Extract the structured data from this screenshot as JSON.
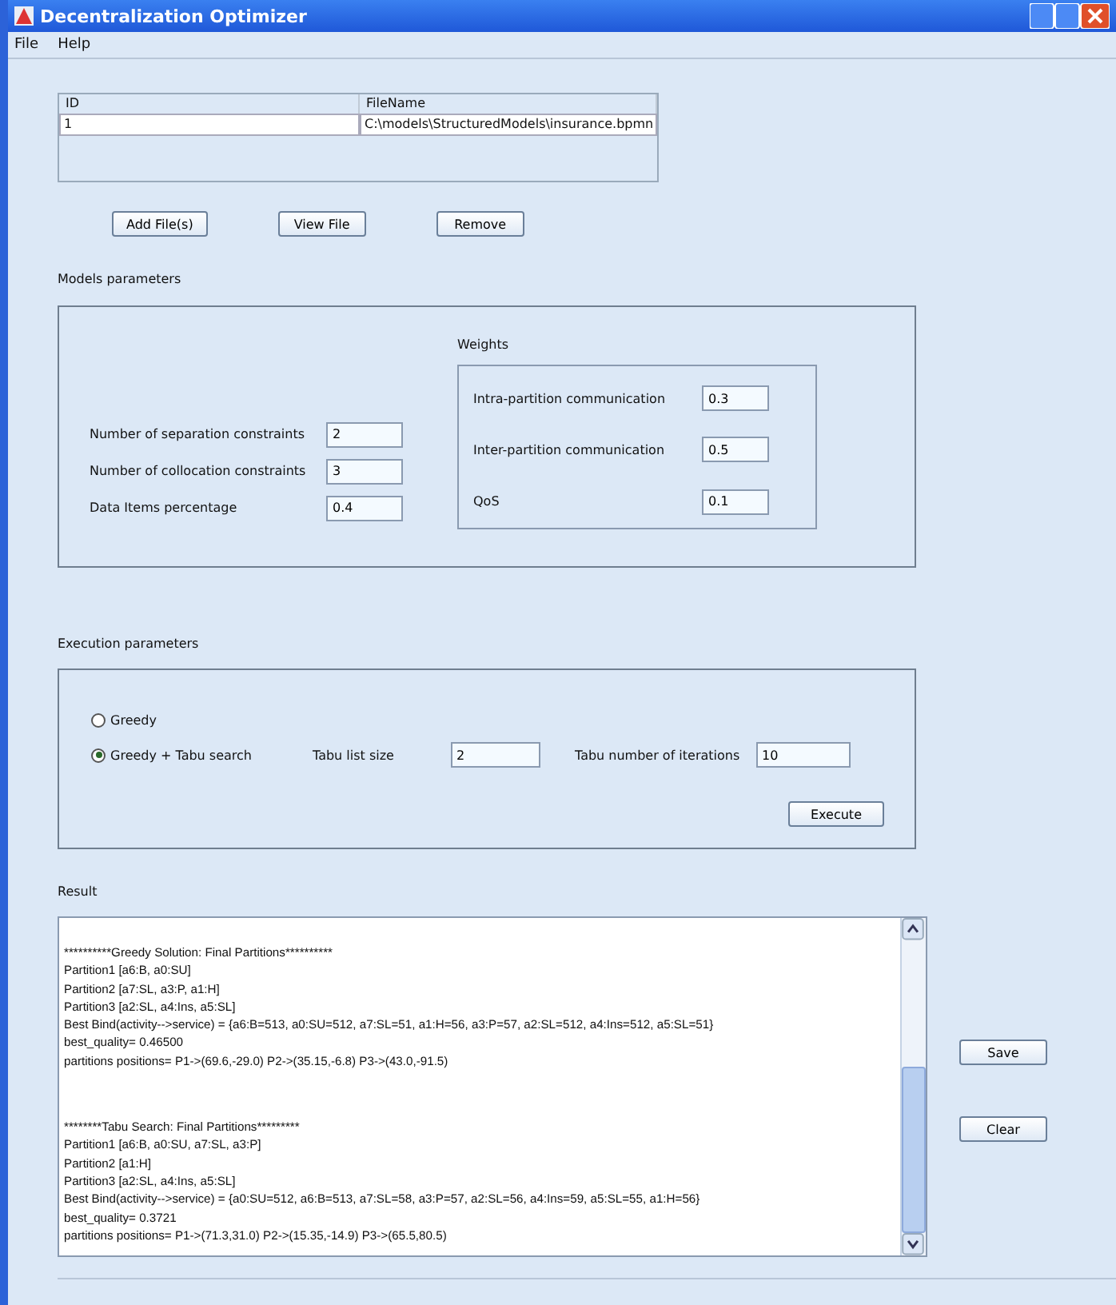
{
  "window": {
    "title": "Decentralization Optimizer"
  },
  "menu": [
    "File",
    "Help"
  ],
  "files_table": {
    "columns": [
      "ID",
      "FileName"
    ],
    "rows": [
      [
        "1",
        "C:\\models\\StructuredModels\\insurance.bpmn"
      ]
    ]
  },
  "file_buttons": [
    "Add File(s)",
    "View File",
    "Remove"
  ],
  "models": {
    "title": "Models parameters",
    "fields": [
      {
        "label": "Number of separation constraints",
        "value": "2"
      },
      {
        "label": "Number of collocation constraints",
        "value": "3"
      },
      {
        "label": "Data Items percentage",
        "value": "0.4"
      }
    ],
    "weights": {
      "title": "Weights",
      "fields": [
        {
          "label": "Intra-partition communication",
          "value": "0.3"
        },
        {
          "label": "Inter-partition communication",
          "value": "0.5"
        },
        {
          "label": "QoS",
          "value": "0.1"
        }
      ]
    }
  },
  "execution": {
    "title": "Execution parameters",
    "options": [
      {
        "label": "Greedy",
        "selected": false
      },
      {
        "label": "Greedy + Tabu search",
        "selected": true
      }
    ],
    "tabu_list_size": {
      "label": "Tabu list size",
      "value": "2"
    },
    "tabu_iterations": {
      "label": "Tabu number of iterations",
      "value": "10"
    },
    "button": "Execute"
  },
  "result": {
    "title": "Result",
    "blocks": [
      [
        "**********Greedy Solution: Final Partitions**********",
        "Partition1 [a6:B, a0:SU]",
        "Partition2 [a7:SL, a3:P, a1:H]",
        "Partition3 [a2:SL, a4:Ins, a5:SL]",
        "Best Bind(activity-->service) = {a6:B=513, a0:SU=512, a7:SL=51, a1:H=56, a3:P=57, a2:SL=512, a4:Ins=512, a5:SL=51}",
        "best_quality= 0.46500",
        "partitions positions= P1->(69.6,-29.0) P2->(35.15,-6.8) P3->(43.0,-91.5)"
      ],
      [
        "********Tabu Search: Final Partitions*********",
        "Partition1 [a6:B, a0:SU, a7:SL, a3:P]",
        "Partition2 [a1:H]",
        "Partition3 [a2:SL, a4:Ins, a5:SL]",
        "Best Bind(activity-->service) = {a0:SU=512, a6:B=513, a7:SL=58, a3:P=57, a2:SL=56, a4:Ins=59, a5:SL=55, a1:H=56}",
        "best_quality= 0.3721",
        "partitions positions= P1->(71.3,31.0) P2->(15.35,-14.9) P3->(65.5,80.5)"
      ]
    ],
    "buttons": [
      "Save",
      "Clear"
    ]
  }
}
